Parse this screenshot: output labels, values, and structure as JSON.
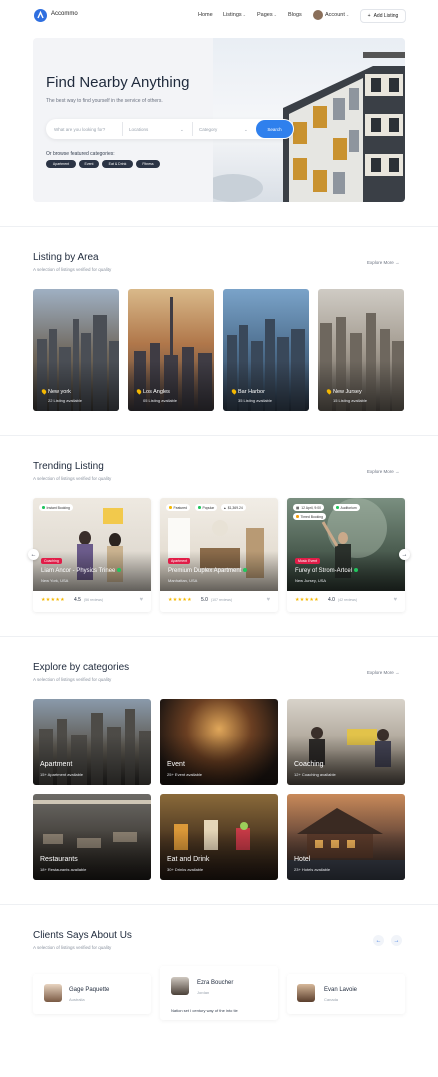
{
  "brand": {
    "name": "Accommo",
    "accent": "#2f6fe0"
  },
  "nav": {
    "home": "Home",
    "listings": "Listings",
    "pages": "Pages",
    "blogs": "Blogs",
    "account": "Account",
    "add_listing": "Add Listing"
  },
  "hero": {
    "title": "Find Nearby Anything",
    "subtitle": "The best way to find yourself in the service of others.",
    "search_placeholder": "What are you looking for?",
    "location_placeholder": "Locations",
    "category_placeholder": "Category",
    "search_button": "Search",
    "browse_label": "Or browse featured categories:",
    "chips": [
      "Apartment",
      "Event",
      "Eat & Drink",
      "Fitness"
    ]
  },
  "area": {
    "title": "Listing by Area",
    "subtitle": "A selection of listings verified for quality",
    "explore": "Explore More",
    "cards": [
      {
        "name": "New york",
        "count": "22 Listing available"
      },
      {
        "name": "Los Angles",
        "count": "05 Listing available"
      },
      {
        "name": "Bar Harbor",
        "count": "35 Listing available"
      },
      {
        "name": "New Jursey",
        "count": "15 Listing available"
      }
    ]
  },
  "trending": {
    "title": "Trending Listing",
    "subtitle": "A selection of listings verified for quality",
    "explore": "Explore More",
    "cards": [
      {
        "badges": [
          "Instant Booking"
        ],
        "tag": "Coaching",
        "name": "Liam Ancor - Physics Trinee",
        "location": "New York, USA",
        "stars": "★★★★★",
        "rating": "4.5",
        "reviews": "(56 reviews)"
      },
      {
        "badges": [
          "Featured",
          "Popular",
          "$1,369.24"
        ],
        "tag": "Apartment",
        "name": "Premium Duplex Apartment",
        "location": "Manhattan, USA",
        "stars": "★★★★★",
        "rating": "5.0",
        "reviews": "(107 reviews)"
      },
      {
        "badges": [
          "12 April, 9:00",
          "Auditorium",
          "Timed Booking"
        ],
        "tag": "Music Event",
        "name": "Furey of Strom-Artcel",
        "location": "New Jursey, USA",
        "stars": "★★★★★",
        "rating": "4.0",
        "reviews": "(42 reviews)"
      }
    ]
  },
  "categories": {
    "title": "Explore by categories",
    "subtitle": "A selection of listings verified for quality",
    "explore": "Explore More",
    "cards": [
      {
        "name": "Apartment",
        "count": "15+ Apartment available"
      },
      {
        "name": "Event",
        "count": "25+ Event available"
      },
      {
        "name": "Coaching",
        "count": "12+ Coaching available"
      },
      {
        "name": "Restaurants",
        "count": "18+ Restaurants available"
      },
      {
        "name": "Eat and Drink",
        "count": "30+ Drinks available"
      },
      {
        "name": "Hotel",
        "count": "23+ Hotels available"
      }
    ]
  },
  "clients": {
    "title": "Clients Says About Us",
    "subtitle": "A selection of listings verified for quality",
    "items": [
      {
        "name": "Gage Paquette",
        "location": "Australia"
      },
      {
        "name": "Ezra Boucher",
        "location": "Jordan",
        "quote": "Nation set I century way of the into tie"
      },
      {
        "name": "Evan Lavoie",
        "location": "Canada"
      }
    ]
  }
}
